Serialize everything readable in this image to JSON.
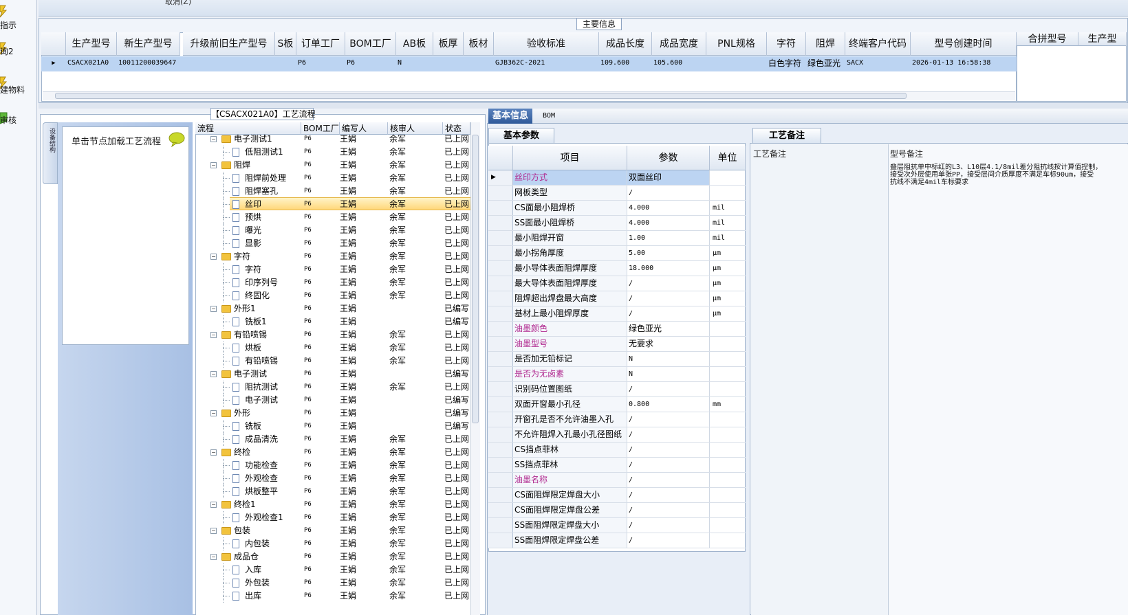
{
  "left_nav": {
    "items": [
      {
        "label": "指示"
      },
      {
        "label": "询2"
      },
      {
        "label": "建物料"
      },
      {
        "label": "审核"
      }
    ]
  },
  "top_bar": {
    "partial_text": "取消(Z)"
  },
  "main_info": {
    "title": "主要信息",
    "columns": [
      "生产型号",
      "新生产型号",
      "升级前旧生产型号",
      "S板",
      "订单工厂",
      "BOM工厂",
      "AB板",
      "板厚",
      "板材",
      "验收标准",
      "成品长度",
      "成品宽度",
      "PNL规格",
      "字符",
      "阻焊",
      "终端客户代码",
      "型号创建时间"
    ],
    "row": [
      "CSACX021A0",
      "10011200039647",
      "",
      "",
      "P6",
      "P6",
      "N",
      "",
      "",
      "GJB362C-2021",
      "109.600",
      "105.600",
      "",
      "白色字符",
      "绿色亚光",
      "SACX",
      "2026-01-13 16:58:38"
    ],
    "side_columns": [
      "合拼型号",
      "生产型"
    ]
  },
  "flow": {
    "title": "【CSACX021A0】工艺流程",
    "left_tab_label": "设备结构",
    "hint": "单击节点加载工艺流程",
    "columns": [
      "流程",
      "BOM工厂",
      "编写人",
      "核审人",
      "状态"
    ],
    "rows": [
      {
        "name": "电子测试1",
        "level": 0,
        "factory": "P6",
        "writer": "王娟",
        "reviewer": "余军",
        "status": "已上网"
      },
      {
        "name": "低阻测试1",
        "level": 1,
        "factory": "P6",
        "writer": "王娟",
        "reviewer": "余军",
        "status": "已上网"
      },
      {
        "name": "阻焊",
        "level": 0,
        "factory": "P6",
        "writer": "王娟",
        "reviewer": "余军",
        "status": "已上网"
      },
      {
        "name": "阻焊前处理",
        "level": 1,
        "factory": "P6",
        "writer": "王娟",
        "reviewer": "余军",
        "status": "已上网"
      },
      {
        "name": "阻焊塞孔",
        "level": 1,
        "factory": "P6",
        "writer": "王娟",
        "reviewer": "余军",
        "status": "已上网"
      },
      {
        "name": "丝印",
        "level": 1,
        "factory": "P6",
        "writer": "王娟",
        "reviewer": "余军",
        "status": "已上网",
        "selected": true
      },
      {
        "name": "预烘",
        "level": 1,
        "factory": "P6",
        "writer": "王娟",
        "reviewer": "余军",
        "status": "已上网"
      },
      {
        "name": "曝光",
        "level": 1,
        "factory": "P6",
        "writer": "王娟",
        "reviewer": "余军",
        "status": "已上网"
      },
      {
        "name": "显影",
        "level": 1,
        "factory": "P6",
        "writer": "王娟",
        "reviewer": "余军",
        "status": "已上网"
      },
      {
        "name": "字符",
        "level": 0,
        "factory": "P6",
        "writer": "王娟",
        "reviewer": "余军",
        "status": "已上网"
      },
      {
        "name": "字符",
        "level": 1,
        "factory": "P6",
        "writer": "王娟",
        "reviewer": "余军",
        "status": "已上网"
      },
      {
        "name": "印序列号",
        "level": 1,
        "factory": "P6",
        "writer": "王娟",
        "reviewer": "余军",
        "status": "已上网"
      },
      {
        "name": "终固化",
        "level": 1,
        "factory": "P6",
        "writer": "王娟",
        "reviewer": "余军",
        "status": "已上网"
      },
      {
        "name": "外形1",
        "level": 0,
        "factory": "P6",
        "writer": "王娟",
        "reviewer": "",
        "status": "已编写"
      },
      {
        "name": "铣板1",
        "level": 1,
        "factory": "P6",
        "writer": "王娟",
        "reviewer": "",
        "status": "已编写"
      },
      {
        "name": "有铅喷锡",
        "level": 0,
        "factory": "P6",
        "writer": "王娟",
        "reviewer": "余军",
        "status": "已上网"
      },
      {
        "name": "烘板",
        "level": 1,
        "factory": "P6",
        "writer": "王娟",
        "reviewer": "余军",
        "status": "已上网"
      },
      {
        "name": "有铅喷锡",
        "level": 1,
        "factory": "P6",
        "writer": "王娟",
        "reviewer": "余军",
        "status": "已上网"
      },
      {
        "name": "电子测试",
        "level": 0,
        "factory": "P6",
        "writer": "王娟",
        "reviewer": "",
        "status": "已编写"
      },
      {
        "name": "阻抗测试",
        "level": 1,
        "factory": "P6",
        "writer": "王娟",
        "reviewer": "余军",
        "status": "已上网"
      },
      {
        "name": "电子测试",
        "level": 1,
        "factory": "P6",
        "writer": "王娟",
        "reviewer": "",
        "status": "已编写"
      },
      {
        "name": "外形",
        "level": 0,
        "factory": "P6",
        "writer": "王娟",
        "reviewer": "",
        "status": "已编写"
      },
      {
        "name": "铣板",
        "level": 1,
        "factory": "P6",
        "writer": "王娟",
        "reviewer": "",
        "status": "已编写"
      },
      {
        "name": "成品清洗",
        "level": 1,
        "factory": "P6",
        "writer": "王娟",
        "reviewer": "余军",
        "status": "已上网"
      },
      {
        "name": "终检",
        "level": 0,
        "factory": "P6",
        "writer": "王娟",
        "reviewer": "余军",
        "status": "已上网"
      },
      {
        "name": "功能检查",
        "level": 1,
        "factory": "P6",
        "writer": "王娟",
        "reviewer": "余军",
        "status": "已上网"
      },
      {
        "name": "外观检查",
        "level": 1,
        "factory": "P6",
        "writer": "王娟",
        "reviewer": "余军",
        "status": "已上网"
      },
      {
        "name": "烘板整平",
        "level": 1,
        "factory": "P6",
        "writer": "王娟",
        "reviewer": "余军",
        "status": "已上网"
      },
      {
        "name": "终检1",
        "level": 0,
        "factory": "P6",
        "writer": "王娟",
        "reviewer": "余军",
        "status": "已上网"
      },
      {
        "name": "外观检查1",
        "level": 1,
        "factory": "P6",
        "writer": "王娟",
        "reviewer": "余军",
        "status": "已上网"
      },
      {
        "name": "包装",
        "level": 0,
        "factory": "P6",
        "writer": "王娟",
        "reviewer": "余军",
        "status": "已上网"
      },
      {
        "name": "内包装",
        "level": 1,
        "factory": "P6",
        "writer": "王娟",
        "reviewer": "余军",
        "status": "已上网"
      },
      {
        "name": "成品仓",
        "level": 0,
        "factory": "P6",
        "writer": "王娟",
        "reviewer": "余军",
        "status": "已上网"
      },
      {
        "name": "入库",
        "level": 1,
        "factory": "P6",
        "writer": "王娟",
        "reviewer": "余军",
        "status": "已上网"
      },
      {
        "name": "外包装",
        "level": 1,
        "factory": "P6",
        "writer": "王娟",
        "reviewer": "余军",
        "status": "已上网"
      },
      {
        "name": "出库",
        "level": 1,
        "factory": "P6",
        "writer": "王娟",
        "reviewer": "余军",
        "status": "已上网"
      }
    ]
  },
  "info": {
    "tabs": [
      "基本信息",
      "BOM"
    ],
    "subtab_params": "基本参数",
    "subtab_craft": "工艺备注",
    "param_headers": [
      "项目",
      "参数",
      "单位"
    ],
    "params": [
      {
        "item": "丝印方式",
        "value": "双面丝印",
        "unit": "",
        "highlight": true,
        "selected": true
      },
      {
        "item": "网板类型",
        "value": "/",
        "unit": ""
      },
      {
        "item": "CS面最小阻焊桥",
        "value": "4.000",
        "unit": "mil"
      },
      {
        "item": "SS面最小阻焊桥",
        "value": "4.000",
        "unit": "mil"
      },
      {
        "item": "最小阻焊开窗",
        "value": "1.00",
        "unit": "mil"
      },
      {
        "item": "最小拐角厚度",
        "value": "5.00",
        "unit": "μm"
      },
      {
        "item": "最小导体表面阻焊厚度",
        "value": "18.000",
        "unit": "μm"
      },
      {
        "item": "最大导体表面阻焊厚度",
        "value": "/",
        "unit": "μm"
      },
      {
        "item": "阻焊超出焊盘最大高度",
        "value": "/",
        "unit": "μm"
      },
      {
        "item": "基材上最小阻焊厚度",
        "value": "/",
        "unit": "μm"
      },
      {
        "item": "油墨颜色",
        "value": "绿色亚光",
        "unit": "",
        "highlight": true
      },
      {
        "item": "油墨型号",
        "value": "无要求",
        "unit": "",
        "highlight": true
      },
      {
        "item": "是否加无铅标记",
        "value": "N",
        "unit": ""
      },
      {
        "item": "是否为无卤素",
        "value": "N",
        "unit": "",
        "highlight": true
      },
      {
        "item": "识别码位置图纸",
        "value": "/",
        "unit": ""
      },
      {
        "item": "双面开窗最小孔径",
        "value": "0.800",
        "unit": "mm"
      },
      {
        "item": "开窗孔是否不允许油墨入孔",
        "value": "/",
        "unit": ""
      },
      {
        "item": "不允许阻焊入孔最小孔径图纸",
        "value": "/",
        "unit": ""
      },
      {
        "item": "CS挡点菲林",
        "value": "/",
        "unit": ""
      },
      {
        "item": "SS挡点菲林",
        "value": "/",
        "unit": ""
      },
      {
        "item": "油墨名称",
        "value": "/",
        "unit": "",
        "highlight": true
      },
      {
        "item": "CS面阻焊限定焊盘大小",
        "value": "/",
        "unit": ""
      },
      {
        "item": "CS面阻焊限定焊盘公差",
        "value": "/",
        "unit": ""
      },
      {
        "item": "SS面阻焊限定焊盘大小",
        "value": "/",
        "unit": ""
      },
      {
        "item": "SS面阻焊限定焊盘公差",
        "value": "/",
        "unit": ""
      }
    ],
    "remark_headers": [
      "工艺备注",
      "型号备注"
    ],
    "model_remark": "叠层阻抗单中标红的L3、L10层4.1/8mil差分阻抗线按计算值控制，\n接受次外层使用单张PP，接受层间介质厚度不满足车标90um，接受\n抗线不满足4mil车标要求",
    "colors": {
      "highlight_text": "#b0288f",
      "accent": "#2f5a9a"
    }
  }
}
